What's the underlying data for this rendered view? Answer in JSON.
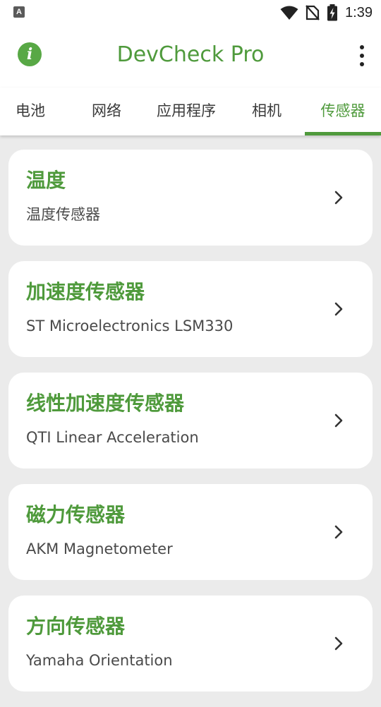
{
  "status_bar": {
    "notification_letter": "A",
    "time": "1:39",
    "icons": [
      "wifi-icon",
      "no-sim-icon",
      "battery-charging-icon"
    ]
  },
  "app_bar": {
    "title": "DevCheck Pro",
    "left_icon": "info-icon",
    "right_icon": "more-vertical-icon"
  },
  "tabs": {
    "items": [
      {
        "label": "电池"
      },
      {
        "label": "网络"
      },
      {
        "label": "应用程序"
      },
      {
        "label": "相机"
      },
      {
        "label": "传感器"
      }
    ],
    "selected": "传感器"
  },
  "sensors": [
    {
      "title": "温度",
      "subtitle": "温度传感器"
    },
    {
      "title": "加速度传感器",
      "subtitle": "ST Microelectronics LSM330"
    },
    {
      "title": "线性加速度传感器",
      "subtitle": "QTI Linear Acceleration"
    },
    {
      "title": "磁力传感器",
      "subtitle": "AKM Magnetometer"
    },
    {
      "title": "方向传感器",
      "subtitle": "Yamaha Orientation"
    }
  ],
  "colors": {
    "accent": "#4f9a3c",
    "background": "#ebebeb",
    "card": "#ffffff"
  }
}
